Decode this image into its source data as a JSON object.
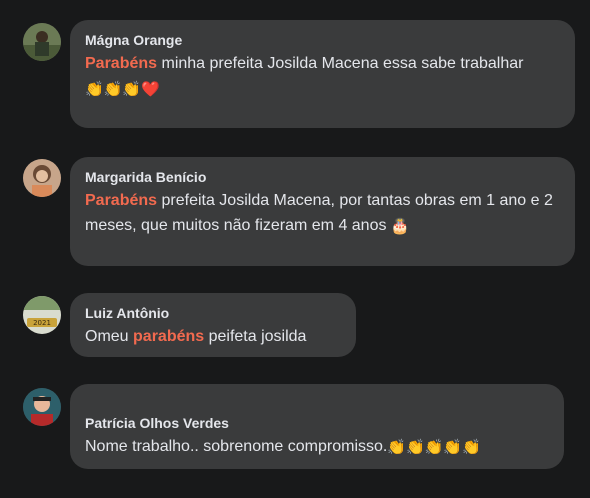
{
  "comments": [
    {
      "author": "Mágna Orange",
      "highlight": "Parabéns",
      "text_before": "",
      "text_after": " minha prefeita Josilda Macena essa sabe trabalhar ",
      "emoji": "👏👏👏❤️"
    },
    {
      "author": "Margarida Benício",
      "highlight": "Parabéns",
      "text_before": "",
      "text_after": " prefeita Josilda Macena, por tantas obras em 1 ano e 2 meses, que muitos não fizeram em 4 anos ",
      "emoji": "🎂"
    },
    {
      "author": "Luiz Antônio",
      "highlight": "parabéns",
      "text_before": "Omeu ",
      "text_after": " peifeta josilda",
      "emoji": ""
    },
    {
      "author": "Patrícia Olhos Verdes",
      "highlight": "",
      "text_before": "Nome trabalho.. sobrenome compromisso.",
      "text_after": "",
      "emoji": "👏👏👏👏👏"
    }
  ],
  "avatar_badge": "2021",
  "colors": {
    "background": "#18191a",
    "bubble": "#3a3b3c",
    "text": "#e4e6eb",
    "highlight": "#f26a4f"
  }
}
